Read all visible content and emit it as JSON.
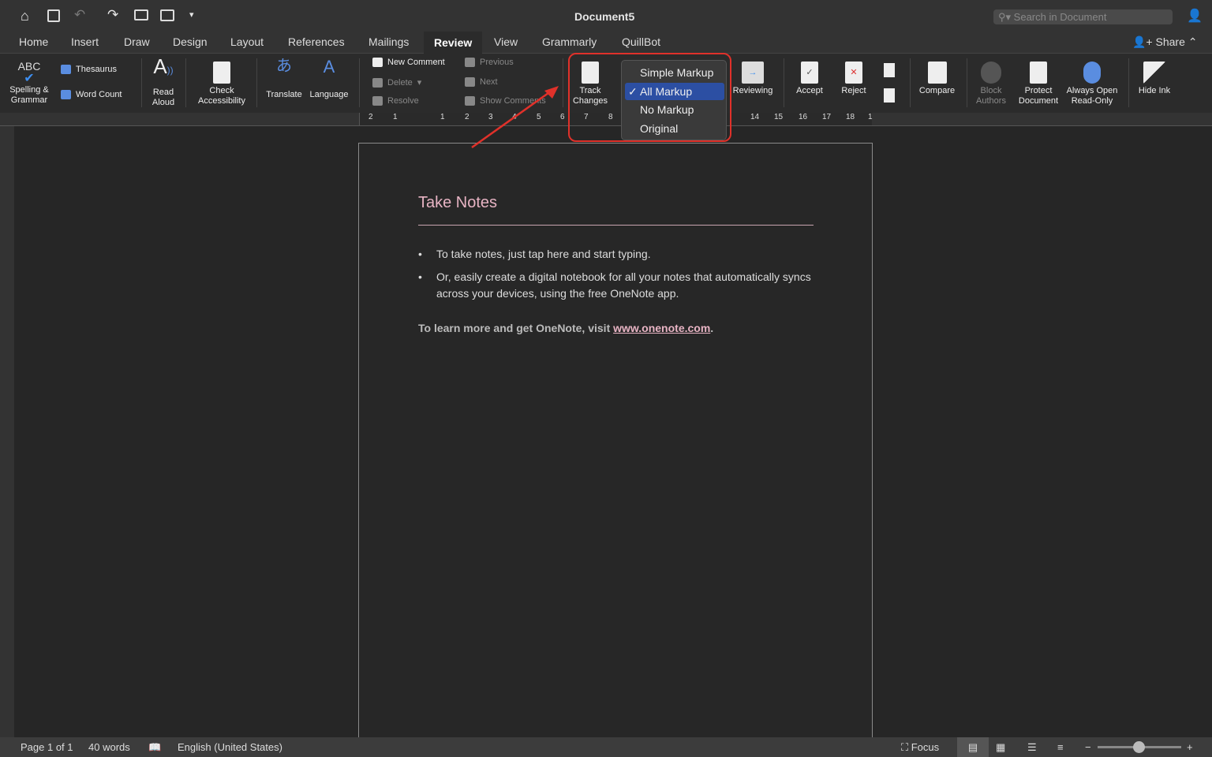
{
  "title": "Document5",
  "search": {
    "placeholder": "Search in Document"
  },
  "tabs": [
    "Home",
    "Insert",
    "Draw",
    "Design",
    "Layout",
    "References",
    "Mailings",
    "Review",
    "View",
    "Grammarly",
    "QuillBot"
  ],
  "active_tab": "Review",
  "share": "Share",
  "ribbon": {
    "spelling": "Spelling &",
    "grammar": "Grammar",
    "abc": "ABC",
    "thesaurus": "Thesaurus",
    "word_count": "Word Count",
    "read": "Read",
    "aloud": "Aloud",
    "check": "Check",
    "accessibility": "Accessibility",
    "translate": "Translate",
    "language": "Language",
    "new_comment": "New Comment",
    "delete": "Delete",
    "resolve": "Resolve",
    "previous": "Previous",
    "next": "Next",
    "show_comments": "Show Comments",
    "track": "Track",
    "changes": "Changes",
    "reviewing": "Reviewing",
    "accept": "Accept",
    "reject": "Reject",
    "compare": "Compare",
    "block": "Block",
    "authors": "Authors",
    "protect": "Protect",
    "document": "Document",
    "always_open": "Always Open",
    "read_only": "Read-Only",
    "hide_ink": "Hide Ink"
  },
  "markup_menu": {
    "items": [
      "Simple Markup",
      "All Markup",
      "No Markup",
      "Original"
    ],
    "selected": "All Markup",
    "check": "✓"
  },
  "ruler": [
    "2",
    "1",
    "1",
    "2",
    "3",
    "4",
    "5",
    "6",
    "7",
    "8",
    "14",
    "15",
    "16",
    "17",
    "18",
    "1"
  ],
  "document": {
    "heading": "Take Notes",
    "bullets": [
      "To take notes, just tap here and start typing.",
      "Or, easily create a digital notebook for all your notes that automatically syncs across your devices, using the free OneNote app."
    ],
    "footer_text": "To learn more and get OneNote, visit ",
    "link": "www.onenote.com",
    "period": "."
  },
  "status": {
    "page": "Page 1 of 1",
    "words": "40 words",
    "language": "English (United States)",
    "focus": "Focus"
  },
  "colors": {
    "accent": "#2c4fa3",
    "highlight": "#e0312a",
    "heading": "#e8b4c4"
  }
}
